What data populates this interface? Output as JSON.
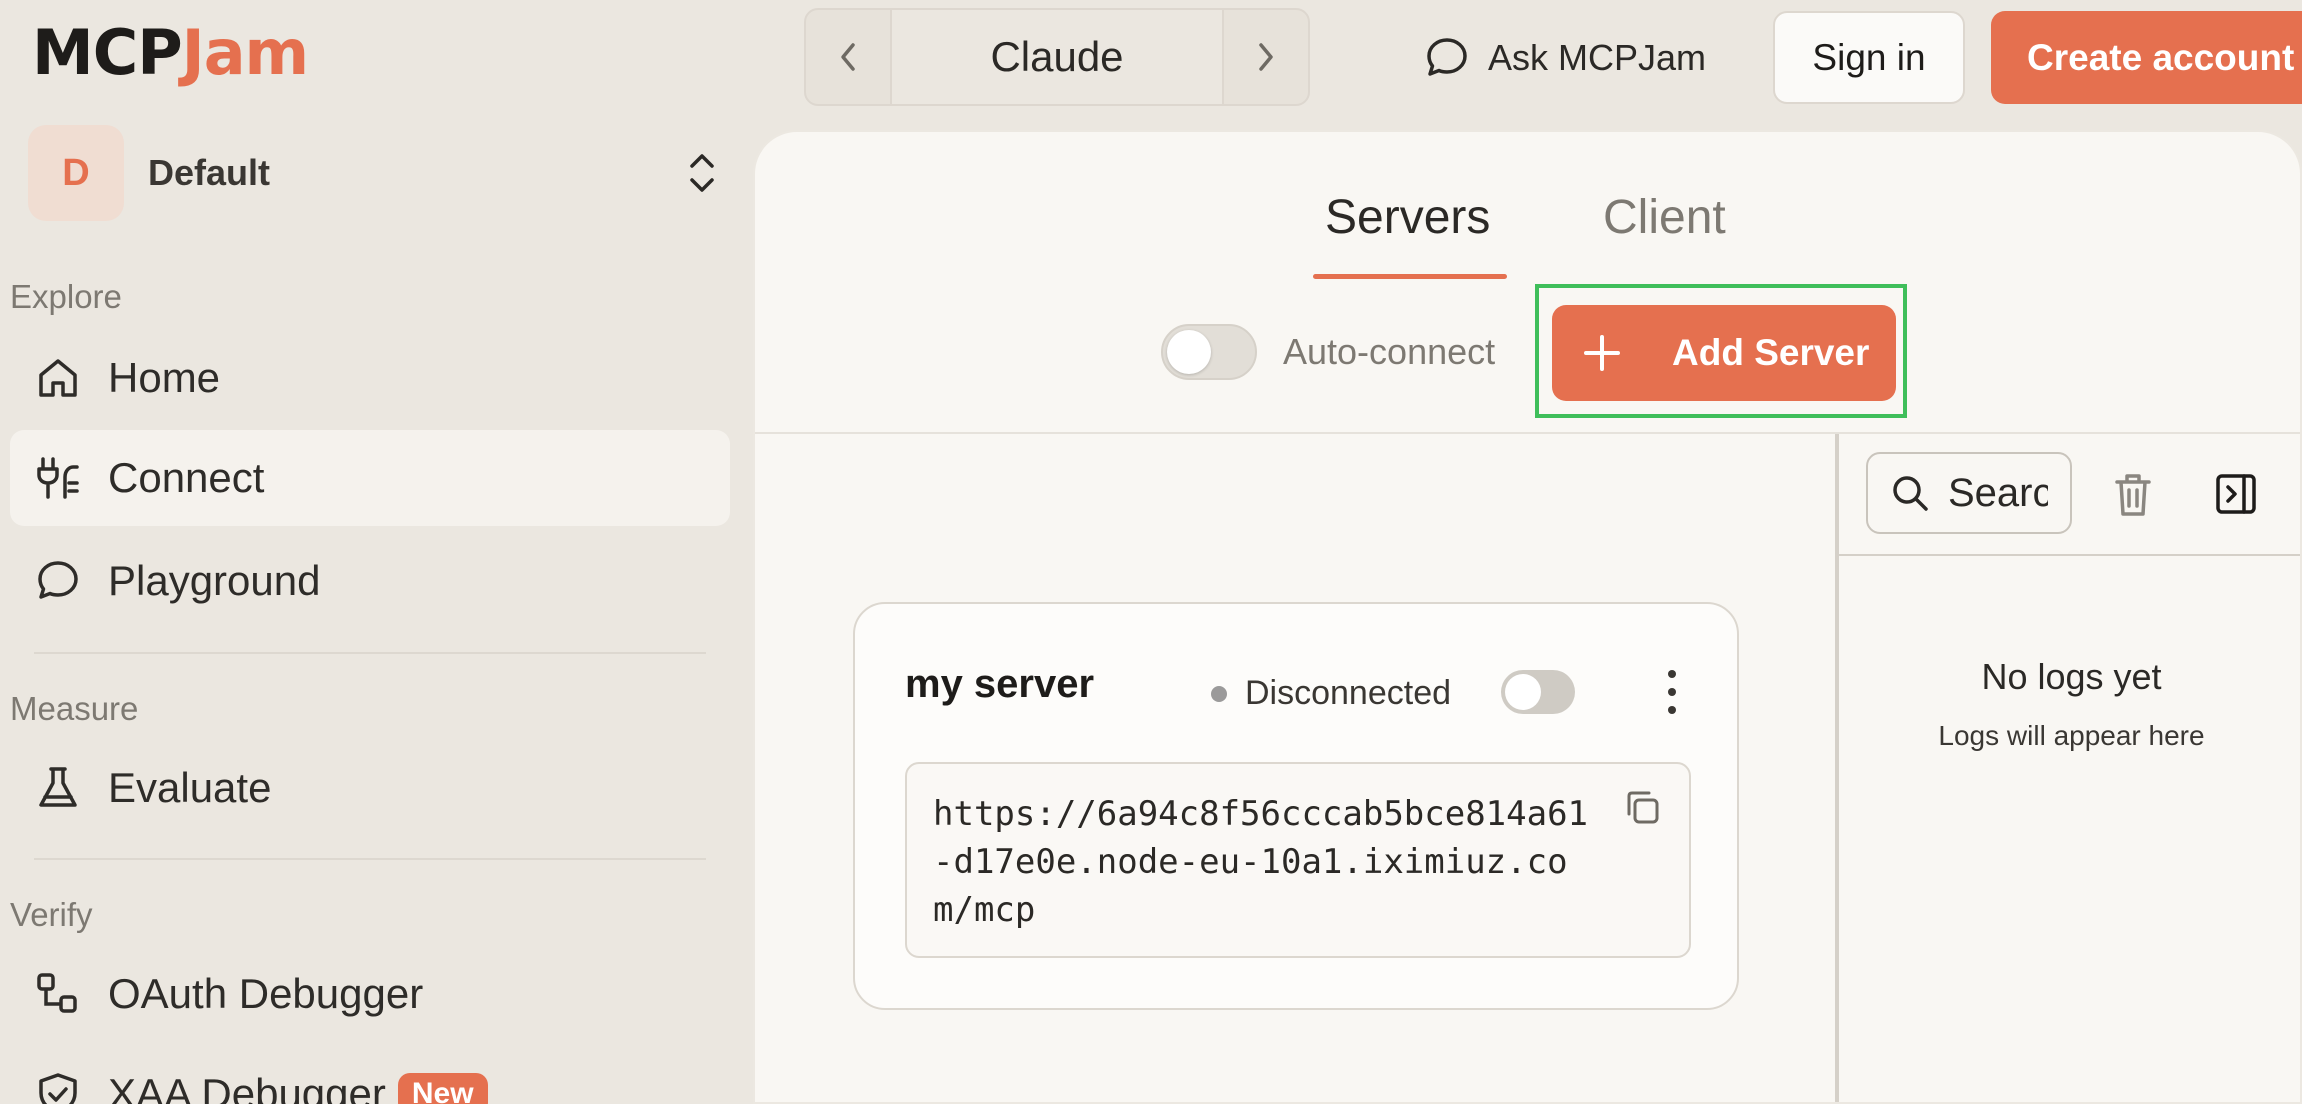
{
  "brand": {
    "logo_left": "MCP",
    "logo_right": "Jam",
    "accent": "#e5704f"
  },
  "topbar": {
    "client_name": "Claude",
    "ask_label": "Ask MCPJam",
    "signin_label": "Sign in",
    "create_label": "Create account"
  },
  "sidebar": {
    "workspace": {
      "initial": "D",
      "name": "Default"
    },
    "sections": [
      {
        "label": "Explore"
      },
      {
        "label": "Measure"
      },
      {
        "label": "Verify"
      }
    ],
    "items": [
      {
        "label": "Home",
        "icon": "home-icon"
      },
      {
        "label": "Connect",
        "icon": "plug-icon",
        "active": true
      },
      {
        "label": "Playground",
        "icon": "chat-bubble-icon"
      },
      {
        "label": "Evaluate",
        "icon": "flask-icon"
      },
      {
        "label": "OAuth Debugger",
        "icon": "flow-icon"
      },
      {
        "label": "XAA Debugger",
        "icon": "shield-check-icon",
        "badge": "New"
      }
    ]
  },
  "main": {
    "tabs": [
      {
        "label": "Servers",
        "active": true
      },
      {
        "label": "Client",
        "active": false
      }
    ],
    "autoconnect_label": "Auto-connect",
    "add_server_label": "Add Server",
    "server": {
      "name": "my server",
      "status": "Disconnected",
      "url": "https://6a94c8f56cccab5bce814a61-d17e0e.node-eu-10a1.iximiuz.com/mcp"
    },
    "logs": {
      "search_placeholder": "Search",
      "empty_title": "No logs yet",
      "empty_subtitle": "Logs will appear here"
    }
  }
}
